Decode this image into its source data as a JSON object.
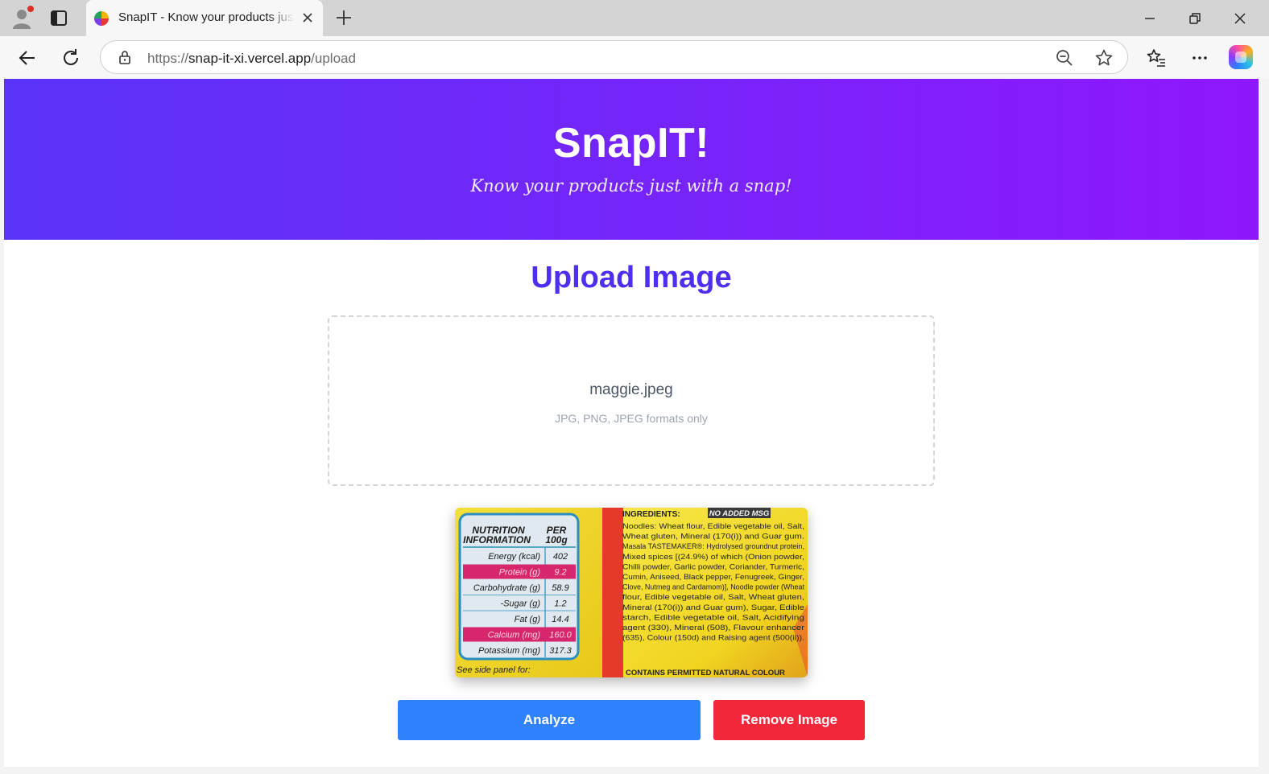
{
  "browser": {
    "tab": {
      "title": "SnapIT - Know your products just with a snap!"
    },
    "address": {
      "scheme": "https://",
      "host": "snap-it-xi.vercel.app",
      "path": "/upload"
    }
  },
  "page": {
    "hero": {
      "title": "SnapIT!",
      "tagline": "Know your products just with a snap!"
    },
    "upload": {
      "heading": "Upload Image",
      "file_name": "maggie.jpeg",
      "hint": "JPG, PNG, JPEG formats only"
    },
    "preview": {
      "nutrition": {
        "heading_line1": "NUTRITION",
        "heading_line2": "INFORMATION",
        "per_line1": "PER",
        "per_line2": "100g",
        "rows": [
          {
            "label": "Energy (kcal)",
            "value": "402"
          },
          {
            "label": "Protein (g)",
            "value": "9.2"
          },
          {
            "label": "Carbohydrate (g)",
            "value": "58.9"
          },
          {
            "label": "-Sugar (g)",
            "value": "1.2"
          },
          {
            "label": "Fat (g)",
            "value": "14.4"
          },
          {
            "label": "Calcium (mg)",
            "value": "160.0"
          },
          {
            "label": "Potassium (mg)",
            "value": "317.3"
          }
        ],
        "footer": "See side panel for:"
      },
      "ingredients": {
        "title": "INGREDIENTS:",
        "badge": "NO ADDED MSG",
        "noodles": "Noodles: Wheat flour, Edible vegetable oil, Salt, Wheat gluten, Mineral (170(i)) and Guar gum.",
        "tastemaker": "Masala TASTEMAKER®: Hydrolysed groundnut protein, Mixed spices [(24.9%) of which (Onion powder, Chilli powder, Garlic powder, Coriander, Turmeric, Cumin, Aniseed, Black pepper, Fenugreek, Ginger, Clove, Nutmeg and Cardamom)], Noodle powder (Wheat flour, Edible vegetable oil, Salt, Wheat gluten, Mineral (170(i)) and Guar gum), Sugar, Edible starch, Edible vegetable oil, Salt, Acidifying agent (330), Mineral (508), Flavour enhancer (635), Colour (150d) and Raising agent (500(ii)).",
        "footer": "CONTAINS PERMITTED NATURAL COLOUR"
      }
    },
    "buttons": {
      "analyze": "Analyze",
      "remove": "Remove Image"
    },
    "colors": {
      "hero_start": "#5a33f8",
      "hero_end": "#8f17fa",
      "heading": "#4c2ff0",
      "analyze": "#2f82fb",
      "remove": "#f2283a"
    }
  }
}
